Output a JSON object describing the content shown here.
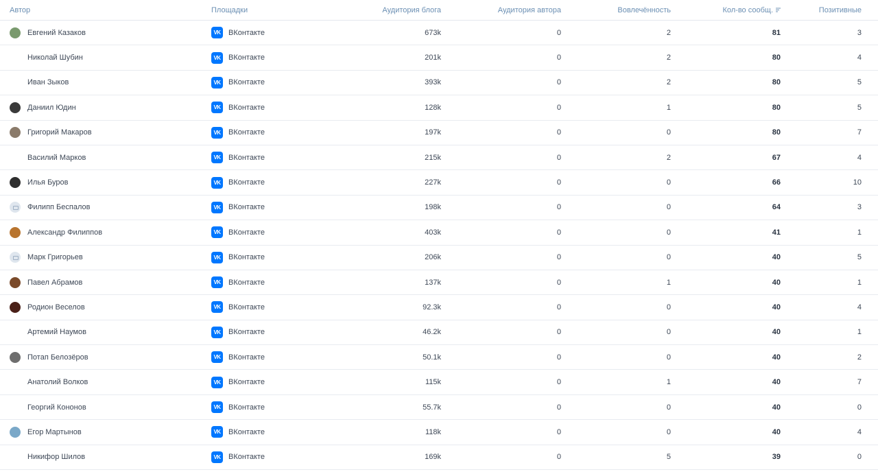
{
  "columns": {
    "author": "Автор",
    "platforms": "Площадки",
    "blog_audience": "Аудитория блога",
    "author_audience": "Аудитория автора",
    "engagement": "Вовлечённость",
    "messages": "Кол-во сообщ.",
    "positive": "Позитивные"
  },
  "platform_icon_text": "VK",
  "rows": [
    {
      "name": "Евгений Казаков",
      "avatar": "#7a9a6e",
      "platform": "ВКонтакте",
      "blog": "673k",
      "auth": "0",
      "eng": "2",
      "msgs": "81",
      "pos": "3"
    },
    {
      "name": "Николай Шубин",
      "avatar": "",
      "platform": "ВКонтакте",
      "blog": "201k",
      "auth": "0",
      "eng": "2",
      "msgs": "80",
      "pos": "4"
    },
    {
      "name": "Иван Зыков",
      "avatar": "",
      "platform": "ВКонтакте",
      "blog": "393k",
      "auth": "0",
      "eng": "2",
      "msgs": "80",
      "pos": "5"
    },
    {
      "name": "Даниил Юдин",
      "avatar": "#3a3a3a",
      "platform": "ВКонтакте",
      "blog": "128k",
      "auth": "0",
      "eng": "1",
      "msgs": "80",
      "pos": "5"
    },
    {
      "name": "Григорий Макаров",
      "avatar": "#8a7a6a",
      "platform": "ВКонтакте",
      "blog": "197k",
      "auth": "0",
      "eng": "0",
      "msgs": "80",
      "pos": "7"
    },
    {
      "name": "Василий Марков",
      "avatar": "",
      "platform": "ВКонтакте",
      "blog": "215k",
      "auth": "0",
      "eng": "2",
      "msgs": "67",
      "pos": "4"
    },
    {
      "name": "Илья Буров",
      "avatar": "#2e2e2e",
      "platform": "ВКонтакте",
      "blog": "227k",
      "auth": "0",
      "eng": "0",
      "msgs": "66",
      "pos": "10"
    },
    {
      "name": "Филипп Беспалов",
      "avatar": "placeholder",
      "platform": "ВКонтакте",
      "blog": "198k",
      "auth": "0",
      "eng": "0",
      "msgs": "64",
      "pos": "3"
    },
    {
      "name": "Александр Филиппов",
      "avatar": "#b8742e",
      "platform": "ВКонтакте",
      "blog": "403k",
      "auth": "0",
      "eng": "0",
      "msgs": "41",
      "pos": "1"
    },
    {
      "name": "Марк Григорьев",
      "avatar": "placeholder",
      "platform": "ВКонтакте",
      "blog": "206k",
      "auth": "0",
      "eng": "0",
      "msgs": "40",
      "pos": "5"
    },
    {
      "name": "Павел Абрамов",
      "avatar": "#7a4a2a",
      "platform": "ВКонтакте",
      "blog": "137k",
      "auth": "0",
      "eng": "1",
      "msgs": "40",
      "pos": "1"
    },
    {
      "name": "Родион Веселов",
      "avatar": "#4a2018",
      "platform": "ВКонтакте",
      "blog": "92.3k",
      "auth": "0",
      "eng": "0",
      "msgs": "40",
      "pos": "4"
    },
    {
      "name": "Артемий Наумов",
      "avatar": "",
      "platform": "ВКонтакте",
      "blog": "46.2k",
      "auth": "0",
      "eng": "0",
      "msgs": "40",
      "pos": "1"
    },
    {
      "name": "Потап Белозёров",
      "avatar": "#6e6e6e",
      "platform": "ВКонтакте",
      "blog": "50.1k",
      "auth": "0",
      "eng": "0",
      "msgs": "40",
      "pos": "2"
    },
    {
      "name": "Анатолий Волков",
      "avatar": "",
      "platform": "ВКонтакте",
      "blog": "115k",
      "auth": "0",
      "eng": "1",
      "msgs": "40",
      "pos": "7"
    },
    {
      "name": "Георгий Кононов",
      "avatar": "",
      "platform": "ВКонтакте",
      "blog": "55.7k",
      "auth": "0",
      "eng": "0",
      "msgs": "40",
      "pos": "0"
    },
    {
      "name": "Егор Мартынов",
      "avatar": "#7aa8c8",
      "platform": "ВКонтакте",
      "blog": "118k",
      "auth": "0",
      "eng": "0",
      "msgs": "40",
      "pos": "4"
    },
    {
      "name": "Никифор Шилов",
      "avatar": "",
      "platform": "ВКонтакте",
      "blog": "169k",
      "auth": "0",
      "eng": "5",
      "msgs": "39",
      "pos": "0"
    }
  ]
}
